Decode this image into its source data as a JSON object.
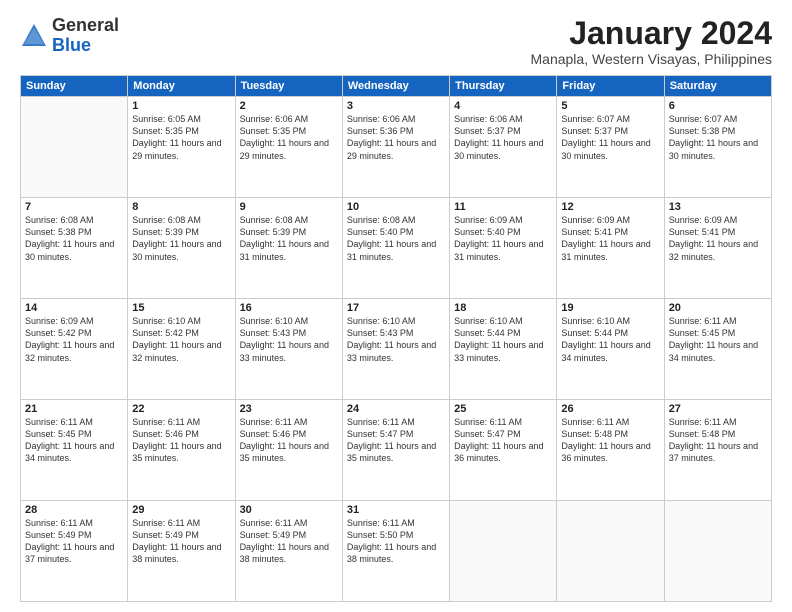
{
  "header": {
    "logo": {
      "line1": "General",
      "line2": "Blue"
    },
    "title": "January 2024",
    "subtitle": "Manapla, Western Visayas, Philippines"
  },
  "weekdays": [
    "Sunday",
    "Monday",
    "Tuesday",
    "Wednesday",
    "Thursday",
    "Friday",
    "Saturday"
  ],
  "weeks": [
    [
      {
        "day": "",
        "sunrise": "",
        "sunset": "",
        "daylight": ""
      },
      {
        "day": "1",
        "sunrise": "Sunrise: 6:05 AM",
        "sunset": "Sunset: 5:35 PM",
        "daylight": "Daylight: 11 hours and 29 minutes."
      },
      {
        "day": "2",
        "sunrise": "Sunrise: 6:06 AM",
        "sunset": "Sunset: 5:35 PM",
        "daylight": "Daylight: 11 hours and 29 minutes."
      },
      {
        "day": "3",
        "sunrise": "Sunrise: 6:06 AM",
        "sunset": "Sunset: 5:36 PM",
        "daylight": "Daylight: 11 hours and 29 minutes."
      },
      {
        "day": "4",
        "sunrise": "Sunrise: 6:06 AM",
        "sunset": "Sunset: 5:37 PM",
        "daylight": "Daylight: 11 hours and 30 minutes."
      },
      {
        "day": "5",
        "sunrise": "Sunrise: 6:07 AM",
        "sunset": "Sunset: 5:37 PM",
        "daylight": "Daylight: 11 hours and 30 minutes."
      },
      {
        "day": "6",
        "sunrise": "Sunrise: 6:07 AM",
        "sunset": "Sunset: 5:38 PM",
        "daylight": "Daylight: 11 hours and 30 minutes."
      }
    ],
    [
      {
        "day": "7",
        "sunrise": "Sunrise: 6:08 AM",
        "sunset": "Sunset: 5:38 PM",
        "daylight": "Daylight: 11 hours and 30 minutes."
      },
      {
        "day": "8",
        "sunrise": "Sunrise: 6:08 AM",
        "sunset": "Sunset: 5:39 PM",
        "daylight": "Daylight: 11 hours and 30 minutes."
      },
      {
        "day": "9",
        "sunrise": "Sunrise: 6:08 AM",
        "sunset": "Sunset: 5:39 PM",
        "daylight": "Daylight: 11 hours and 31 minutes."
      },
      {
        "day": "10",
        "sunrise": "Sunrise: 6:08 AM",
        "sunset": "Sunset: 5:40 PM",
        "daylight": "Daylight: 11 hours and 31 minutes."
      },
      {
        "day": "11",
        "sunrise": "Sunrise: 6:09 AM",
        "sunset": "Sunset: 5:40 PM",
        "daylight": "Daylight: 11 hours and 31 minutes."
      },
      {
        "day": "12",
        "sunrise": "Sunrise: 6:09 AM",
        "sunset": "Sunset: 5:41 PM",
        "daylight": "Daylight: 11 hours and 31 minutes."
      },
      {
        "day": "13",
        "sunrise": "Sunrise: 6:09 AM",
        "sunset": "Sunset: 5:41 PM",
        "daylight": "Daylight: 11 hours and 32 minutes."
      }
    ],
    [
      {
        "day": "14",
        "sunrise": "Sunrise: 6:09 AM",
        "sunset": "Sunset: 5:42 PM",
        "daylight": "Daylight: 11 hours and 32 minutes."
      },
      {
        "day": "15",
        "sunrise": "Sunrise: 6:10 AM",
        "sunset": "Sunset: 5:42 PM",
        "daylight": "Daylight: 11 hours and 32 minutes."
      },
      {
        "day": "16",
        "sunrise": "Sunrise: 6:10 AM",
        "sunset": "Sunset: 5:43 PM",
        "daylight": "Daylight: 11 hours and 33 minutes."
      },
      {
        "day": "17",
        "sunrise": "Sunrise: 6:10 AM",
        "sunset": "Sunset: 5:43 PM",
        "daylight": "Daylight: 11 hours and 33 minutes."
      },
      {
        "day": "18",
        "sunrise": "Sunrise: 6:10 AM",
        "sunset": "Sunset: 5:44 PM",
        "daylight": "Daylight: 11 hours and 33 minutes."
      },
      {
        "day": "19",
        "sunrise": "Sunrise: 6:10 AM",
        "sunset": "Sunset: 5:44 PM",
        "daylight": "Daylight: 11 hours and 34 minutes."
      },
      {
        "day": "20",
        "sunrise": "Sunrise: 6:11 AM",
        "sunset": "Sunset: 5:45 PM",
        "daylight": "Daylight: 11 hours and 34 minutes."
      }
    ],
    [
      {
        "day": "21",
        "sunrise": "Sunrise: 6:11 AM",
        "sunset": "Sunset: 5:45 PM",
        "daylight": "Daylight: 11 hours and 34 minutes."
      },
      {
        "day": "22",
        "sunrise": "Sunrise: 6:11 AM",
        "sunset": "Sunset: 5:46 PM",
        "daylight": "Daylight: 11 hours and 35 minutes."
      },
      {
        "day": "23",
        "sunrise": "Sunrise: 6:11 AM",
        "sunset": "Sunset: 5:46 PM",
        "daylight": "Daylight: 11 hours and 35 minutes."
      },
      {
        "day": "24",
        "sunrise": "Sunrise: 6:11 AM",
        "sunset": "Sunset: 5:47 PM",
        "daylight": "Daylight: 11 hours and 35 minutes."
      },
      {
        "day": "25",
        "sunrise": "Sunrise: 6:11 AM",
        "sunset": "Sunset: 5:47 PM",
        "daylight": "Daylight: 11 hours and 36 minutes."
      },
      {
        "day": "26",
        "sunrise": "Sunrise: 6:11 AM",
        "sunset": "Sunset: 5:48 PM",
        "daylight": "Daylight: 11 hours and 36 minutes."
      },
      {
        "day": "27",
        "sunrise": "Sunrise: 6:11 AM",
        "sunset": "Sunset: 5:48 PM",
        "daylight": "Daylight: 11 hours and 37 minutes."
      }
    ],
    [
      {
        "day": "28",
        "sunrise": "Sunrise: 6:11 AM",
        "sunset": "Sunset: 5:49 PM",
        "daylight": "Daylight: 11 hours and 37 minutes."
      },
      {
        "day": "29",
        "sunrise": "Sunrise: 6:11 AM",
        "sunset": "Sunset: 5:49 PM",
        "daylight": "Daylight: 11 hours and 38 minutes."
      },
      {
        "day": "30",
        "sunrise": "Sunrise: 6:11 AM",
        "sunset": "Sunset: 5:49 PM",
        "daylight": "Daylight: 11 hours and 38 minutes."
      },
      {
        "day": "31",
        "sunrise": "Sunrise: 6:11 AM",
        "sunset": "Sunset: 5:50 PM",
        "daylight": "Daylight: 11 hours and 38 minutes."
      },
      {
        "day": "",
        "sunrise": "",
        "sunset": "",
        "daylight": ""
      },
      {
        "day": "",
        "sunrise": "",
        "sunset": "",
        "daylight": ""
      },
      {
        "day": "",
        "sunrise": "",
        "sunset": "",
        "daylight": ""
      }
    ]
  ]
}
